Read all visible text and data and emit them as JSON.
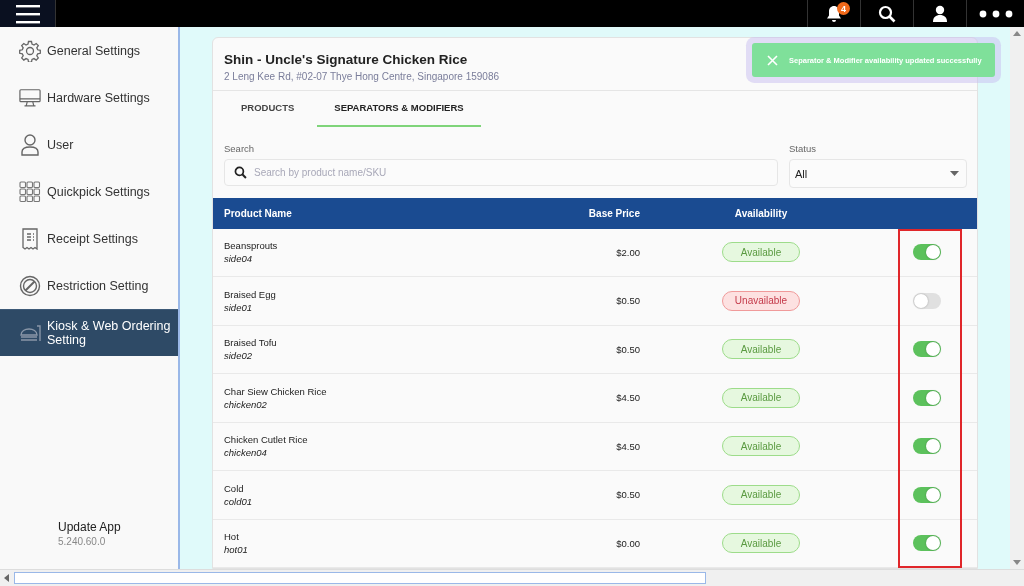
{
  "topbar": {
    "notification_count": "4"
  },
  "sidebar": {
    "items": [
      {
        "label": "General Settings",
        "selected": false
      },
      {
        "label": "Hardware Settings",
        "selected": false
      },
      {
        "label": "User",
        "selected": false
      },
      {
        "label": "Quickpick Settings",
        "selected": false
      },
      {
        "label": "Receipt Settings",
        "selected": false
      },
      {
        "label": "Restriction Setting",
        "selected": false
      },
      {
        "label": "Kiosk & Web Ordering Setting",
        "selected": true
      }
    ],
    "footer": {
      "title": "Update App",
      "version": "5.240.60.0"
    }
  },
  "store": {
    "name": "Shin - Uncle's Signature Chicken Rice",
    "address": "2 Leng Kee Rd, #02-07 Thye Hong Centre, Singapore 159086"
  },
  "tabs": [
    {
      "label": "PRODUCTS",
      "selected": false
    },
    {
      "label": "SEPARATORS & MODIFIERS",
      "selected": true
    }
  ],
  "filters": {
    "search_label": "Search",
    "search_placeholder": "Search by product name/SKU",
    "status_label": "Status",
    "status_value": "All"
  },
  "toast": {
    "message": "Separator & Modifier availability updated successfully"
  },
  "table": {
    "columns": [
      "Product Name",
      "Base Price",
      "Availability"
    ],
    "rows": [
      {
        "name": "Beansprouts",
        "sku": "side04",
        "price": "$2.00",
        "status": "Available",
        "available": true,
        "on": true
      },
      {
        "name": "Braised Egg",
        "sku": "side01",
        "price": "$0.50",
        "status": "Unavailable",
        "available": false,
        "on": false
      },
      {
        "name": "Braised Tofu",
        "sku": "side02",
        "price": "$0.50",
        "status": "Available",
        "available": true,
        "on": true
      },
      {
        "name": "Char Siew Chicken Rice",
        "sku": "chicken02",
        "price": "$4.50",
        "status": "Available",
        "available": true,
        "on": true
      },
      {
        "name": "Chicken Cutlet Rice",
        "sku": "chicken04",
        "price": "$4.50",
        "status": "Available",
        "available": true,
        "on": true
      },
      {
        "name": "Cold",
        "sku": "cold01",
        "price": "$0.50",
        "status": "Available",
        "available": true,
        "on": true
      },
      {
        "name": "Hot",
        "sku": "hot01",
        "price": "$0.00",
        "status": "Available",
        "available": true,
        "on": true
      }
    ]
  }
}
